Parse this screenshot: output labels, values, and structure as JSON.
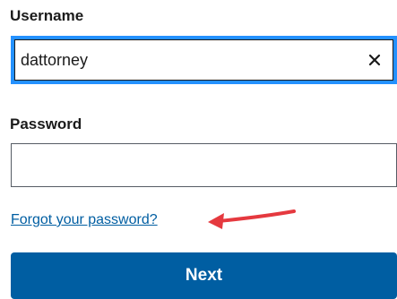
{
  "username": {
    "label": "Username",
    "value": "dattorney",
    "clear_icon": "close-icon"
  },
  "password": {
    "label": "Password",
    "value": ""
  },
  "forgot_link": "Forgot your password?",
  "annotation": {
    "icon": "arrow-left-icon",
    "color": "#e5393f"
  },
  "next_button": "Next",
  "colors": {
    "focus_ring": "#2491ff",
    "link": "#005ea2",
    "primary_button": "#005ea2"
  }
}
